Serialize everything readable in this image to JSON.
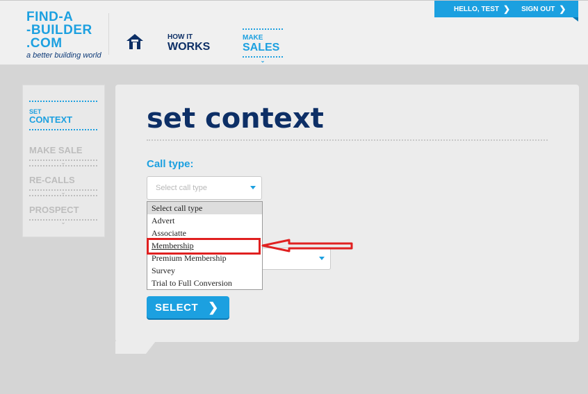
{
  "header": {
    "logo_lines": [
      "FIND-A",
      "-BUILDER",
      ".COM"
    ],
    "logo_tagline": "a better building world",
    "nav": {
      "how_small": "HOW IT",
      "how_large": "WORKS",
      "make_small": "MAKE",
      "make_large": "SALES"
    },
    "user": {
      "greeting": "HELLO, TEST",
      "signout": "SIGN OUT"
    },
    "icons": {
      "home": "home-icon",
      "chevron": "chevron-right-icon"
    }
  },
  "sidebar": {
    "items": [
      {
        "small": "SET",
        "label": "CONTEXT",
        "active": true
      },
      {
        "label": "MAKE SALE",
        "active": false
      },
      {
        "label": "RE-CALLS",
        "active": false
      },
      {
        "label": "PROSPECT",
        "active": false
      }
    ]
  },
  "main": {
    "title": "set context",
    "call_type_label": "Call type:",
    "select_placeholder": "Select call type",
    "dropdown_options": [
      "Select call type",
      "Advert",
      "Associatte",
      "Membership",
      "Premium Membership",
      "Survey",
      "Trial to Full Conversion"
    ],
    "selected_option_index": 0,
    "highlighted_option": "Membership",
    "select_button": "SELECT"
  },
  "colors": {
    "accent": "#1ca0e0",
    "navy": "#0d2f66",
    "annotation_red": "#e02020",
    "background": "#d5d5d5"
  }
}
